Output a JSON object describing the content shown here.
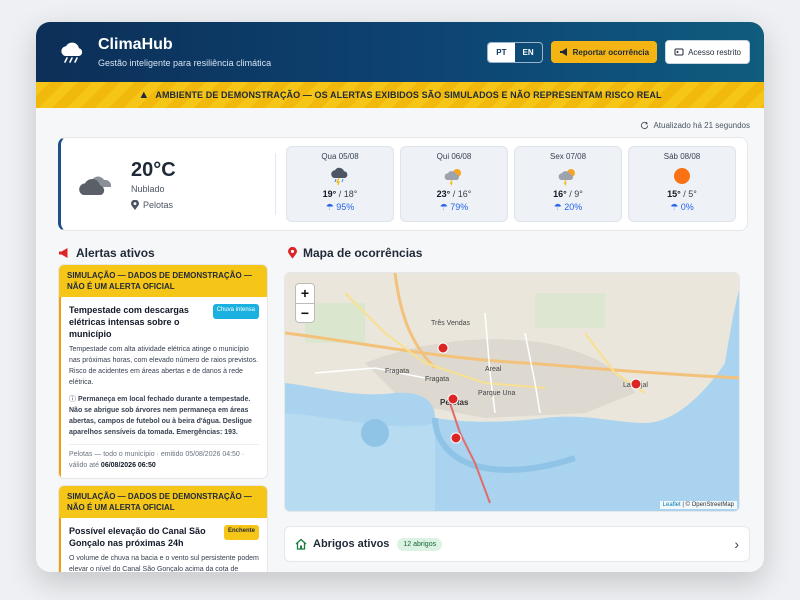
{
  "header": {
    "app_name": "ClimaHub",
    "subtitle": "Gestão inteligente para resiliência climática",
    "lang_pt": "PT",
    "lang_en": "EN",
    "report_label": "Reportar ocorrência",
    "access_label": "Acesso restrito"
  },
  "banner": {
    "text": "AMBIENTE DE DEMONSTRAÇÃO — OS ALERTAS EXIBIDOS SÃO SIMULADOS E NÃO REPRESENTAM RISCO REAL"
  },
  "status": {
    "updated": "Atualizado há 21 segundos"
  },
  "current": {
    "temp": "20°C",
    "condition": "Nublado",
    "city": "Pelotas"
  },
  "forecast": [
    {
      "day": "Qua 05/08",
      "max": "19°",
      "min": "18°",
      "rain": "95%",
      "icon": "storm-icon"
    },
    {
      "day": "Qui 06/08",
      "max": "23°",
      "min": "16°",
      "rain": "79%",
      "icon": "sun-storm-icon"
    },
    {
      "day": "Sex 07/08",
      "max": "16°",
      "min": "9°",
      "rain": "20%",
      "icon": "sun-storm-icon"
    },
    {
      "day": "Sáb 08/08",
      "max": "15°",
      "min": "5°",
      "rain": "0%",
      "icon": "sun-icon"
    }
  ],
  "alerts_title": "Alertas ativos",
  "alerts": [
    {
      "head": "SIMULAÇÃO — DADOS DE DEMONSTRAÇÃO — NÃO É UM ALERTA OFICIAL",
      "title": "Tempestade com descargas elétricas intensas sobre o município",
      "tag": "Chuva intensa",
      "desc": "Tempestade com alta atividade elétrica atinge o município nas próximas horas, com elevado número de raios previstos. Risco de acidentes em áreas abertas e de danos à rede elétrica.",
      "info": "Permaneça em local fechado durante a tempestade. Não se abrigue sob árvores nem permaneça em áreas abertas, campos de futebol ou à beira d'água. Desligue aparelhos sensíveis da tomada. Emergências: 193.",
      "meta": "Pelotas — todo o município · emitido 05/08/2026 04:50 · válido até",
      "valid": "06/08/2026 06:50"
    },
    {
      "head": "SIMULAÇÃO — DADOS DE DEMONSTRAÇÃO — NÃO É UM ALERTA OFICIAL",
      "title": "Possível elevação do Canal São Gonçalo nas próximas 24h",
      "tag": "Enchente",
      "desc": "O volume de chuva na bacia e o vento sul persistente podem elevar o nível do Canal São Gonçalo acima da cota de atenção."
    }
  ],
  "map": {
    "title": "Mapa de ocorrências",
    "zoom_in": "+",
    "zoom_out": "−",
    "labels": [
      "Três Vendas",
      "Fragata",
      "Fragata",
      "Areal",
      "Pelotas",
      "Parque Una",
      "Laranjal"
    ],
    "attribution_leaflet": "Leaflet",
    "attribution_rest": "| © OpenStreetMap"
  },
  "shelters": {
    "title": "Abrigos ativos",
    "count": "12 abrigos"
  },
  "colors": {
    "primary": "#0d3560",
    "accent": "#f5c518",
    "alert_red": "#dc2626",
    "water": "#a9d3ee"
  }
}
